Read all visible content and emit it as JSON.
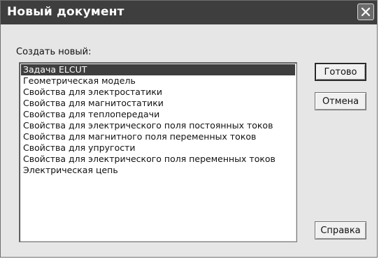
{
  "window": {
    "title": "Новый документ"
  },
  "create_label": "Создать новый:",
  "items": [
    "Задача ELCUT",
    "Геометрическая модель",
    "Свойства для электростатики",
    "Свойства для магнитостатики",
    "Свойства для теплопередачи",
    "Свойства для электрического поля постоянных токов",
    "Свойства для магнитного поля переменных токов",
    "Свойства для упругости",
    "Свойства для электрического поля переменных токов",
    "Электрическая цепь"
  ],
  "selected_item": "Задача ELCUT",
  "buttons": {
    "ok": "Готово",
    "cancel": "Отмена",
    "help": "Справка"
  },
  "icons": {
    "close": "close-icon"
  }
}
